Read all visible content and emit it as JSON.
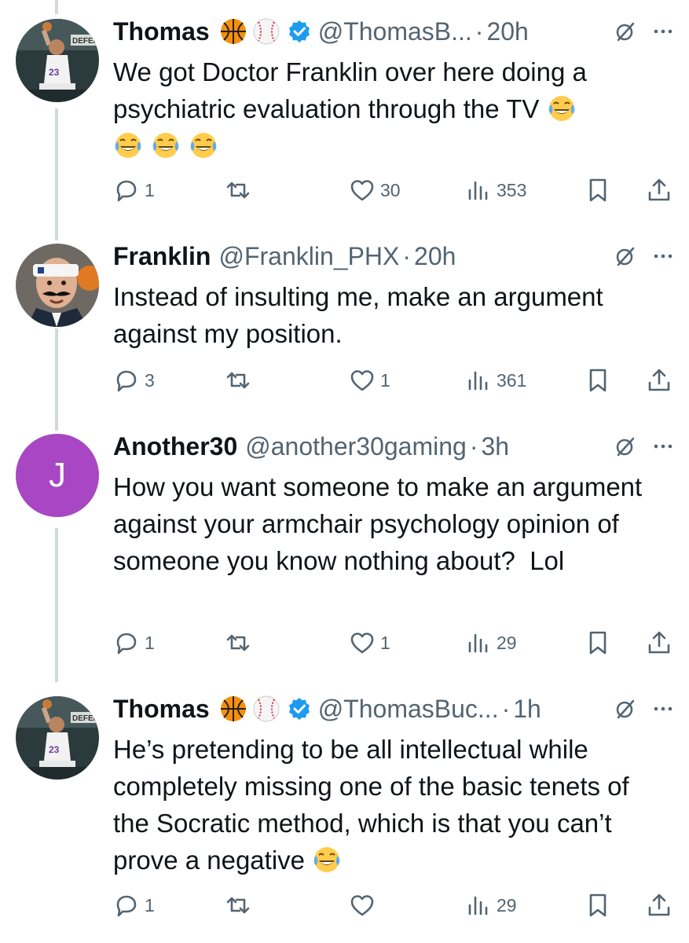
{
  "tweets": [
    {
      "avatar": "basketball-player-photo",
      "name": "Thomas",
      "badges": [
        "basketball-emoji",
        "baseball-emoji"
      ],
      "verified": true,
      "handle": "@ThomasB...",
      "time": "20h",
      "text": "We got Doctor Franklin over here doing a psychiatric evaluation through the TV",
      "trailing_emoji": [
        "tears-of-joy-emoji",
        "tears-of-joy-emoji",
        "tears-of-joy-emoji",
        "tears-of-joy-emoji"
      ],
      "replies": "1",
      "retweets": "",
      "likes": "30",
      "views": "353"
    },
    {
      "avatar": "man-with-headband-photo",
      "name": "Franklin",
      "handle": "@Franklin_PHX",
      "time": "20h",
      "text": "Instead of insulting me, make an argument against my position.",
      "replies": "3",
      "retweets": "",
      "likes": "1",
      "views": "361"
    },
    {
      "avatar_letter": "J",
      "avatar_color": "#a946c3",
      "name": "Another30",
      "handle": "@another30gaming",
      "time": "3h",
      "text": "How you want someone to make an argument against your armchair psychology opinion of someone you know nothing about?  Lol",
      "replies": "1",
      "retweets": "",
      "likes": "1",
      "views": "29"
    },
    {
      "avatar": "basketball-player-photo",
      "name": "Thomas",
      "badges": [
        "basketball-emoji",
        "baseball-emoji"
      ],
      "verified": true,
      "handle": "@ThomasBuc...",
      "time": "1h",
      "text": "He’s pretending to be all intellectual while completely missing one of the basic tenets of the Socratic method, which is that you can’t prove a negative",
      "trailing_emoji": [
        "tears-of-joy-emoji"
      ],
      "replies": "1",
      "retweets": "",
      "likes": "",
      "views": "29"
    }
  ],
  "separator": "·",
  "colors": {
    "text": "#0f1419",
    "secondary": "#536471",
    "thread_line": "#cfd9de",
    "verified": "#1d9bf0"
  }
}
